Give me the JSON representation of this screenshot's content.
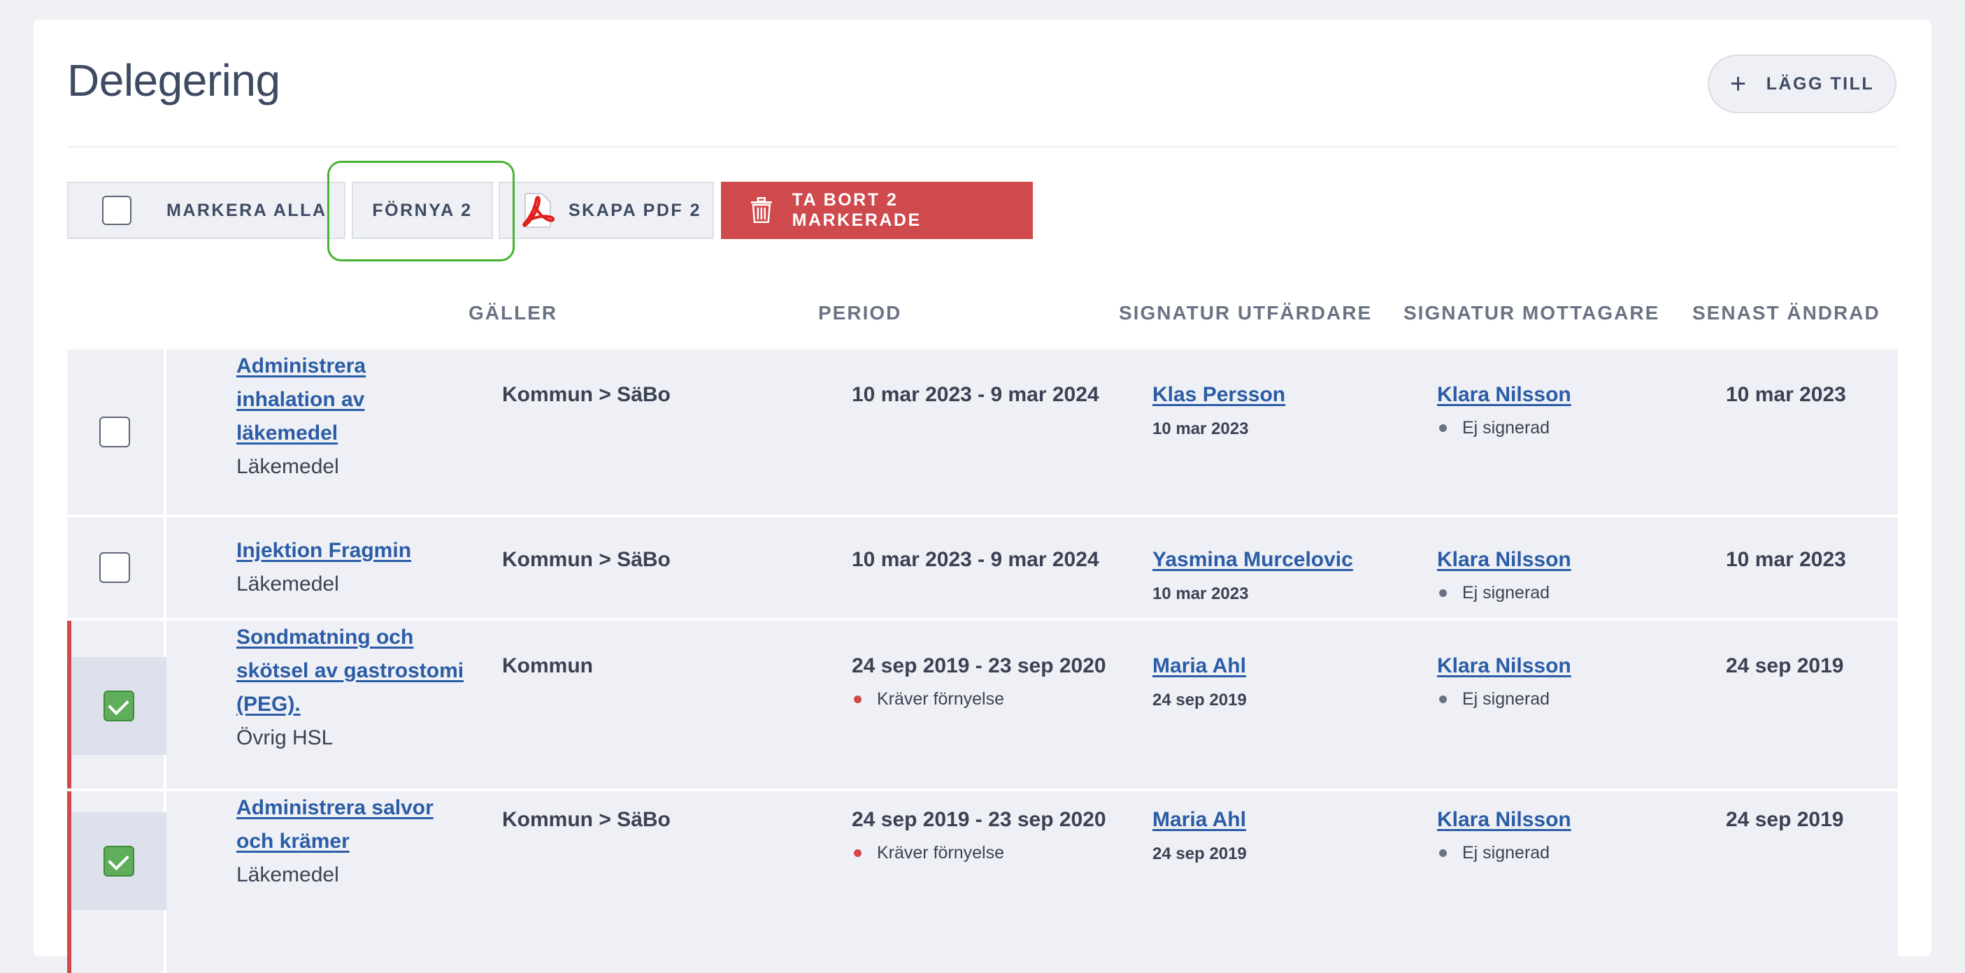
{
  "page": {
    "title": "Delegering",
    "add_label": "LÄGG TILL"
  },
  "toolbar": {
    "mark_all": "MARKERA ALLA",
    "renew": "FÖRNYA 2",
    "create_pdf": "SKAPA PDF 2",
    "delete": "TA BORT 2 MARKERADE"
  },
  "columns": {
    "galler": "GÄLLER",
    "period": "PERIOD",
    "sig_issuer": "SIGNATUR UTFÄRDARE",
    "sig_receiver": "SIGNATUR MOTTAGARE",
    "modified": "SENAST ÄNDRAD"
  },
  "rows": [
    {
      "checked": false,
      "name_lines": [
        "Administrera",
        "inhalation av",
        "läkemedel"
      ],
      "category": "Läkemedel",
      "galler": "Kommun > SäBo",
      "period": "10 mar 2023 - 9 mar 2024",
      "period_status": "",
      "issuer": "Klas Persson",
      "issuer_date": "10 mar 2023",
      "receiver": "Klara Nilsson",
      "receiver_status": "Ej signerad",
      "modified": "10 mar 2023"
    },
    {
      "checked": false,
      "name_lines": [
        "Injektion Fragmin"
      ],
      "category": "Läkemedel",
      "galler": "Kommun > SäBo",
      "period": "10 mar 2023 - 9 mar 2024",
      "period_status": "",
      "issuer": "Yasmina Murcelovic",
      "issuer_date": "10 mar 2023",
      "receiver": "Klara Nilsson",
      "receiver_status": "Ej signerad",
      "modified": "10 mar 2023"
    },
    {
      "checked": true,
      "name_lines": [
        "Sondmatning och",
        "skötsel av gastrostomi",
        "(PEG)."
      ],
      "category": "Övrig HSL",
      "galler": "Kommun",
      "period": "24 sep 2019 - 23 sep 2020",
      "period_status": "Kräver förnyelse",
      "issuer": "Maria Ahl",
      "issuer_date": "24 sep 2019",
      "receiver": "Klara Nilsson",
      "receiver_status": "Ej signerad",
      "modified": "24 sep 2019"
    },
    {
      "checked": true,
      "name_lines": [
        "Administrera salvor",
        "och krämer"
      ],
      "category": "Läkemedel",
      "galler": "Kommun > SäBo",
      "period": "24 sep 2019 - 23 sep 2020",
      "period_status": "Kräver förnyelse",
      "issuer": "Maria Ahl",
      "issuer_date": "24 sep 2019",
      "receiver": "Klara Nilsson",
      "receiver_status": "Ej signerad",
      "modified": "24 sep 2019"
    }
  ],
  "colors": {
    "accent_link": "#2b5ca6",
    "danger": "#cf4a4c",
    "highlight": "#48b233",
    "checked": "#5fae5a"
  }
}
